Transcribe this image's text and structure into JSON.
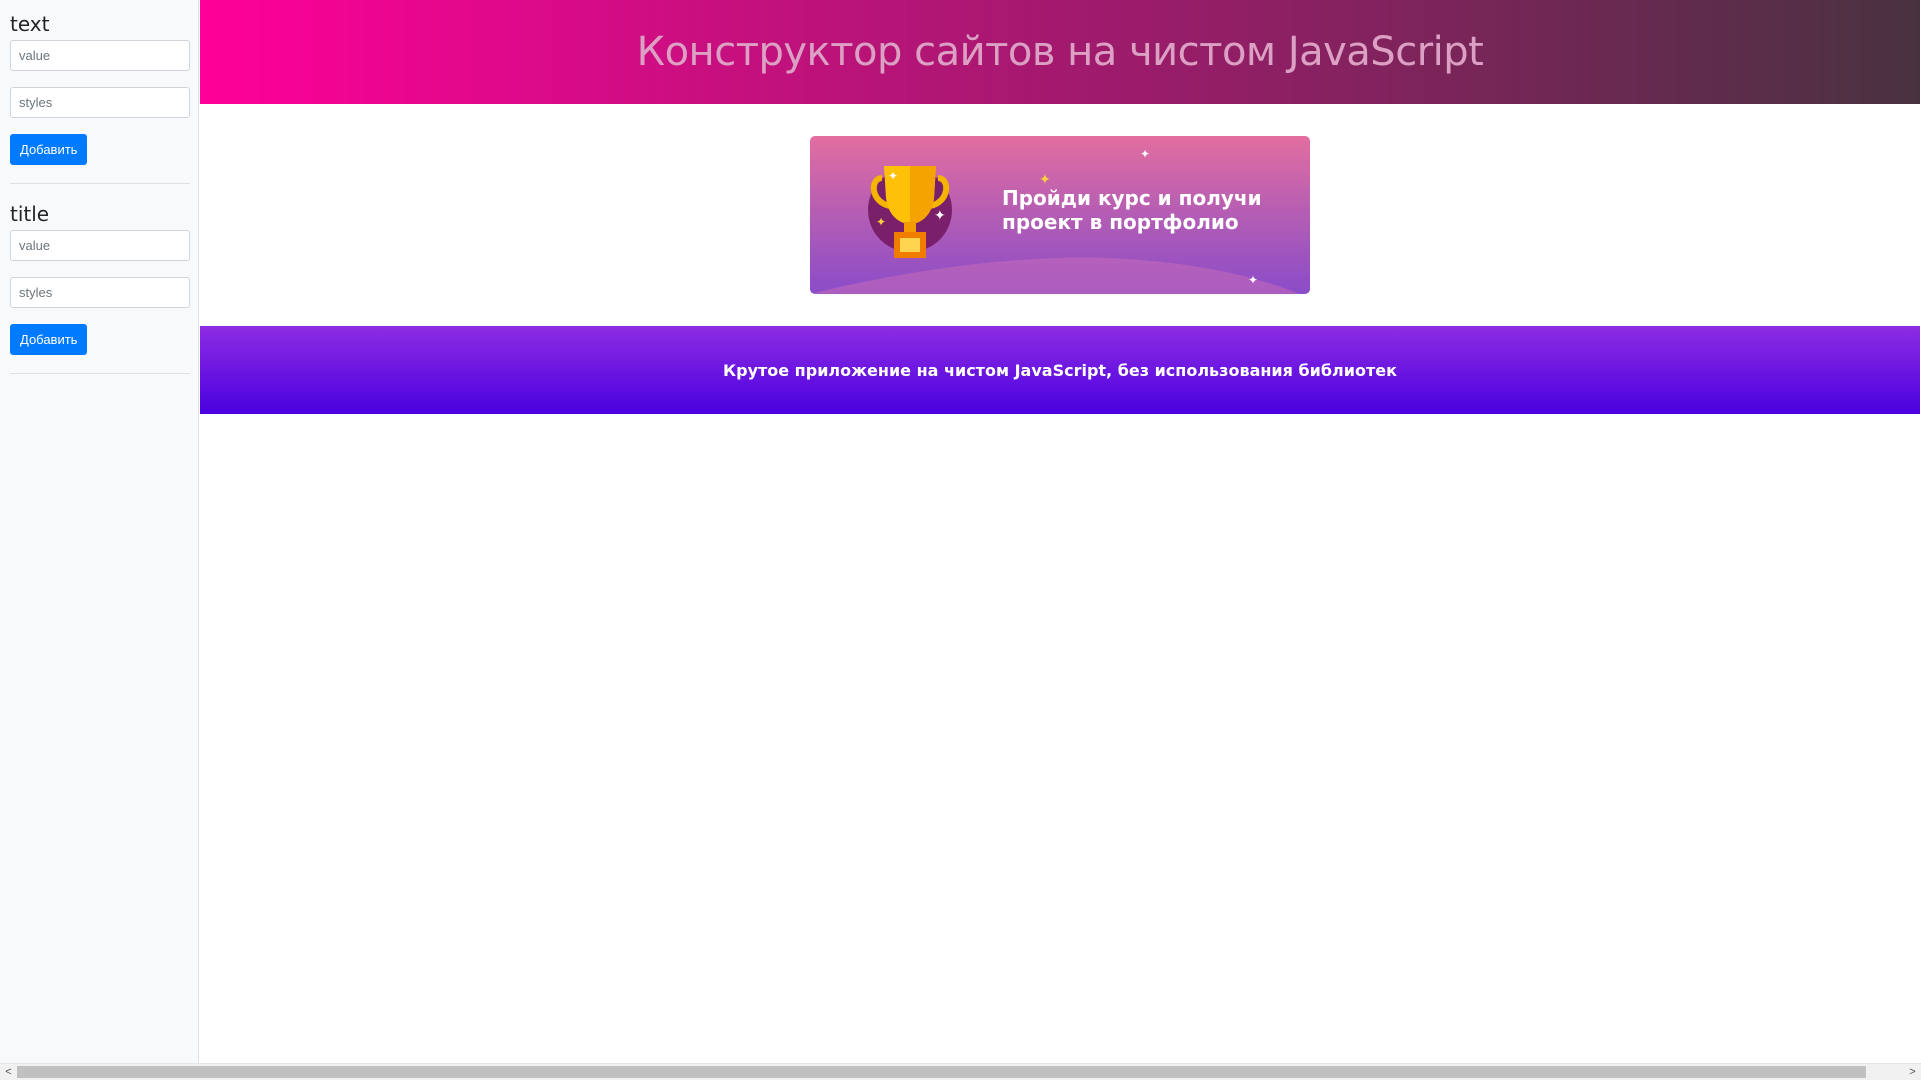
{
  "sidebar": {
    "forms": [
      {
        "title": "text",
        "value_placeholder": "value",
        "styles_placeholder": "styles",
        "button_label": "Добавить"
      },
      {
        "title": "title",
        "value_placeholder": "value",
        "styles_placeholder": "styles",
        "button_label": "Добавить"
      }
    ]
  },
  "site": {
    "header_title": "Конструктор сайтов на чистом JavaScript",
    "banner": {
      "text": "Пройди курс и получи проект в портфолио"
    },
    "footer_text": "Крутое приложение на чистом JavaScript, без использования библиотек"
  },
  "scrollbar": {
    "left_arrow": "<",
    "right_arrow": ">",
    "thumb_fraction": 0.98
  },
  "colors": {
    "header_gradient": [
      "#ff0099",
      "#493240"
    ],
    "footer_gradient": [
      "#8e2de2",
      "#4a00e0"
    ],
    "button": "#007bff"
  }
}
